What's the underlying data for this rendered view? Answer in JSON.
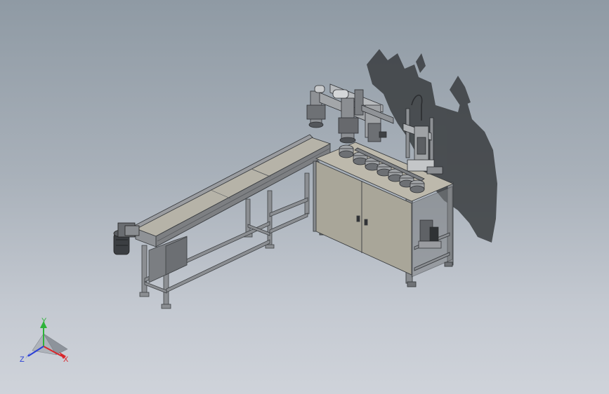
{
  "triad": {
    "x_label": "X",
    "y_label": "Y",
    "z_label": "Z",
    "x_color": "#d9262b",
    "y_color": "#2eb33a",
    "z_color": "#2a3fd6"
  },
  "colors": {
    "background_top": "#8f9aa4",
    "background_bottom": "#cfd3da",
    "frame_metal": "#7f8286",
    "cabinet_panel": "#a9a699",
    "shadow": "#3a3d40"
  }
}
